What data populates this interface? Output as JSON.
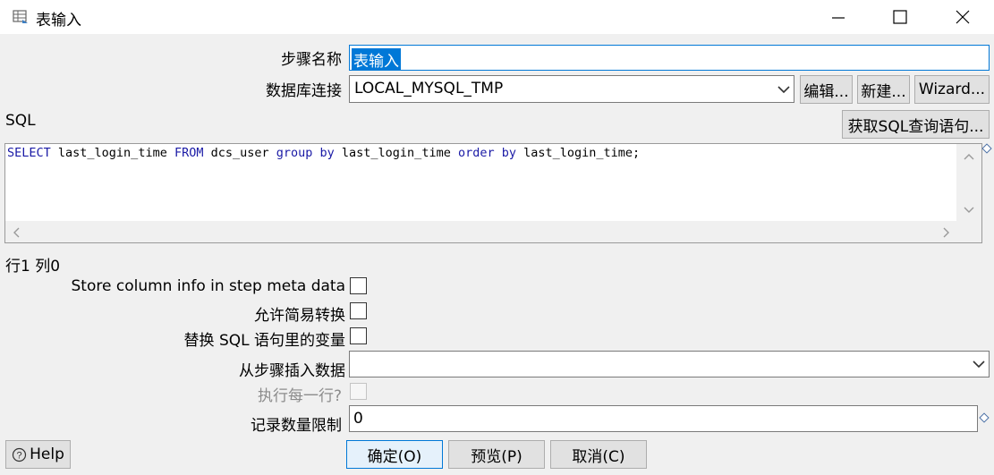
{
  "window": {
    "title": "表输入",
    "icons": {
      "app": "table-input-icon",
      "minimize": "minimize-icon",
      "maximize": "maximize-icon",
      "close": "close-icon"
    }
  },
  "form": {
    "step_name_label": "步骤名称",
    "step_name_value": "表输入",
    "db_connection_label": "数据库连接",
    "db_connection_value": "LOCAL_MYSQL_TMP",
    "edit_button": "编辑...",
    "new_button": "新建...",
    "wizard_button": "Wizard...",
    "sql_label": "SQL",
    "get_sql_button": "获取SQL查询语句...",
    "sql_text": "SELECT last_login_time FROM dcs_user group by last_login_time order by last_login_time;",
    "position_status": "行1 列0",
    "store_column_info_label": "Store column info in step meta data",
    "store_column_info_checked": false,
    "lazy_conversion_label": "允许简易转换",
    "lazy_conversion_checked": false,
    "replace_variables_label": "替换 SQL 语句里的变量",
    "replace_variables_checked": false,
    "insert_from_step_label": "从步骤插入数据",
    "insert_from_step_value": "",
    "execute_each_row_label": "执行每一行?",
    "execute_each_row_checked": false,
    "limit_label": "记录数量限制",
    "limit_value": "0"
  },
  "buttons": {
    "help": "Help",
    "ok": "确定(O)",
    "preview": "预览(P)",
    "cancel": "取消(C)"
  },
  "colors": {
    "selection": "#0078d7",
    "keyword": "#1a1aa6",
    "default_button_border": "#0078d7"
  }
}
